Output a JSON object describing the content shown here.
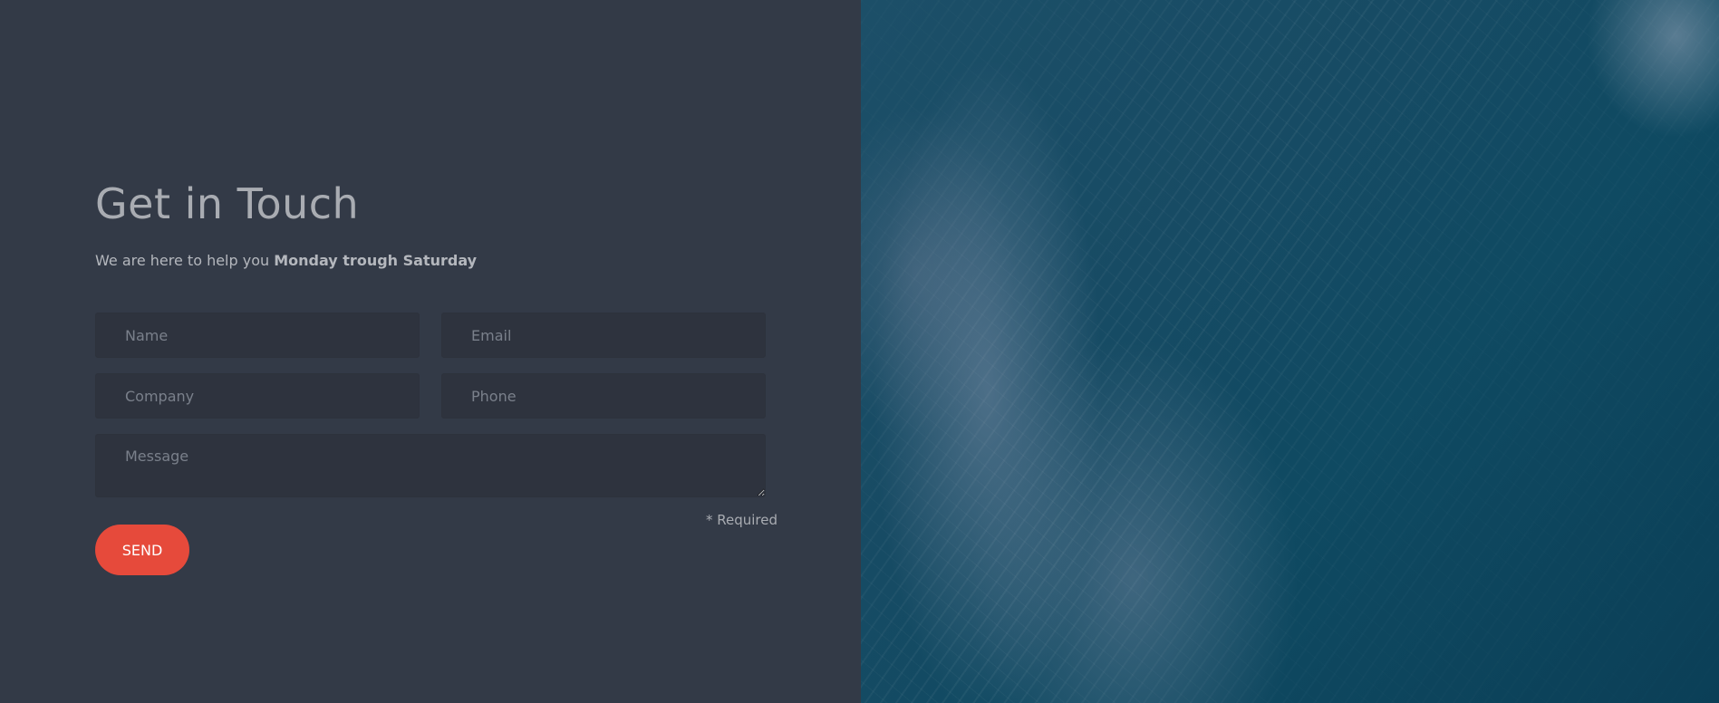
{
  "contact": {
    "title": "Get in Touch",
    "subtitle_prefix": "We are here to help you ",
    "subtitle_bold": "Monday trough Saturday",
    "fields": {
      "name_placeholder": "Name",
      "email_placeholder": "Email",
      "company_placeholder": "Company",
      "phone_placeholder": "Phone",
      "message_placeholder": "Message"
    },
    "required_note": "* Required",
    "send_label": "SEND"
  },
  "colors": {
    "background": "#333a47",
    "accent": "#e64a3b",
    "field_background": "#2e333e"
  },
  "image": {
    "subject": "ocean-waves-aerial"
  }
}
